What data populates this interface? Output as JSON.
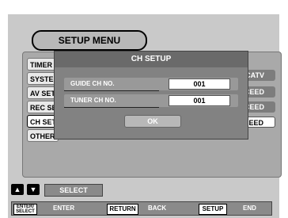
{
  "menu_title": "SETUP MENU",
  "menu_items": [
    {
      "label": "TIMER"
    },
    {
      "label": "SYSTEM"
    },
    {
      "label": "AV SET"
    },
    {
      "label": "REC SET"
    },
    {
      "label": "CH SET"
    },
    {
      "label": "OTHER"
    }
  ],
  "options": [
    {
      "label": "CATV"
    },
    {
      "label": "PROCEED"
    },
    {
      "label": "PROCEED"
    },
    {
      "label": "PROCEED"
    }
  ],
  "dialog": {
    "title": "CH SETUP",
    "rows": [
      {
        "label": "GUIDE CH NO.",
        "value": "001"
      },
      {
        "label": "TUNER CH NO.",
        "value": "001"
      }
    ],
    "ok_label": "OK"
  },
  "footer": {
    "select_label": "SELECT",
    "up_symbol": "▲",
    "down_symbol": "▼",
    "enter_key": "ENTER/\nSELECT",
    "enter_label": "ENTER",
    "return_key": "RETURN",
    "back_label": "BACK",
    "setup_key": "SETUP",
    "end_label": "END"
  }
}
